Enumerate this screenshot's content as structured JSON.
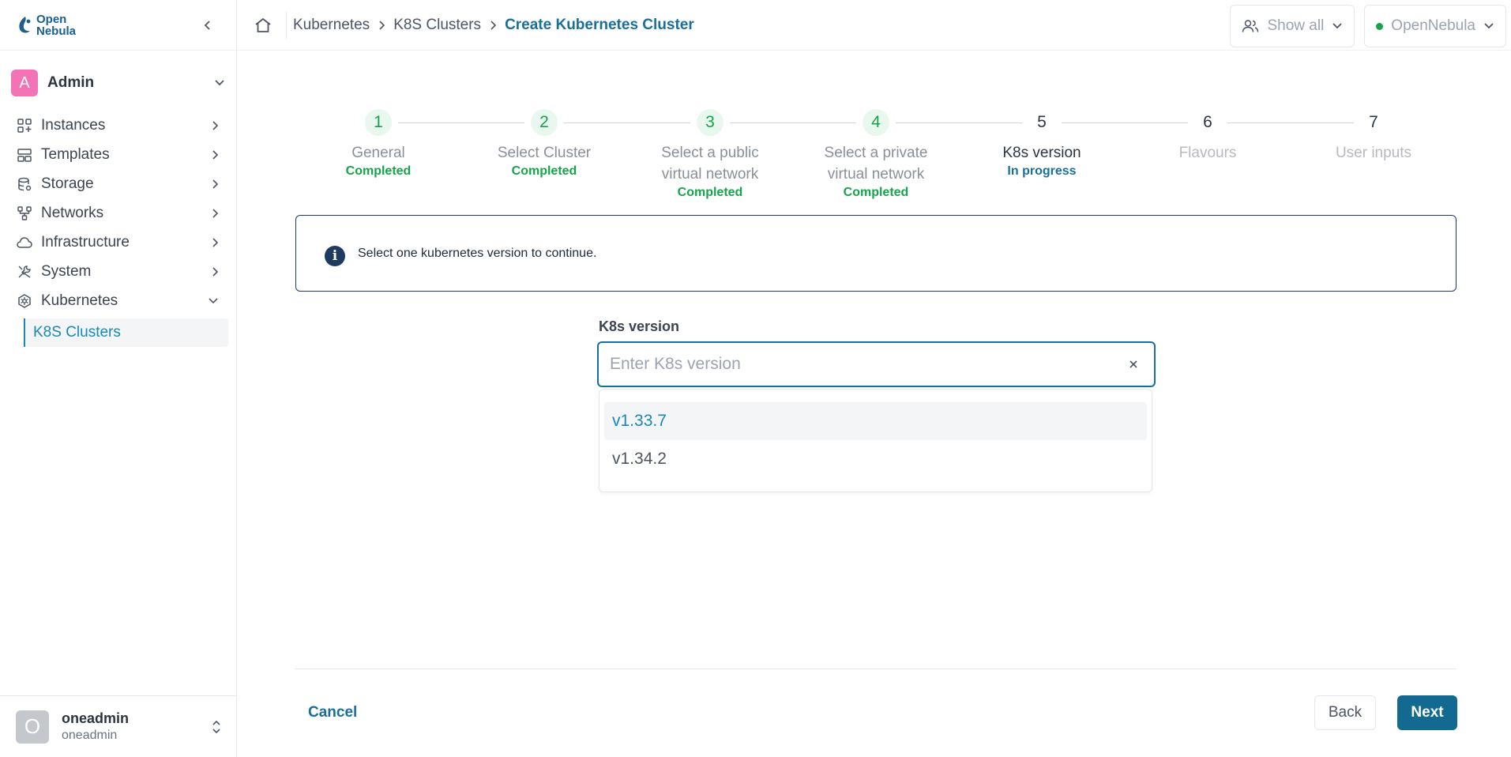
{
  "app": {
    "logo_line1": "Open",
    "logo_line2": "Nebula"
  },
  "sidebar": {
    "group": {
      "avatar_letter": "A",
      "name": "Admin"
    },
    "items": [
      {
        "label": "Instances",
        "icon": "instances-icon"
      },
      {
        "label": "Templates",
        "icon": "templates-icon"
      },
      {
        "label": "Storage",
        "icon": "storage-icon"
      },
      {
        "label": "Networks",
        "icon": "networks-icon"
      },
      {
        "label": "Infrastructure",
        "icon": "cloud-icon"
      },
      {
        "label": "System",
        "icon": "tools-icon"
      },
      {
        "label": "Kubernetes",
        "icon": "kubernetes-icon"
      }
    ],
    "subitem": "K8S Clusters",
    "footer": {
      "avatar_letter": "O",
      "name": "oneadmin",
      "sub": "oneadmin"
    }
  },
  "topbar": {
    "breadcrumbs": [
      "Kubernetes",
      "K8S Clusters"
    ],
    "current": "Create Kubernetes Cluster",
    "show_all": "Show all",
    "zone": "OpenNebula",
    "zone_status_color": "#16a34a"
  },
  "stepper": {
    "steps": [
      {
        "num": "1",
        "label": "General",
        "status": "Completed",
        "state": "done"
      },
      {
        "num": "2",
        "label": "Select Cluster",
        "status": "Completed",
        "state": "done"
      },
      {
        "num": "3",
        "label": "Select a public virtual network",
        "status": "Completed",
        "state": "done"
      },
      {
        "num": "4",
        "label": "Select a private virtual network",
        "status": "Completed",
        "state": "done"
      },
      {
        "num": "5",
        "label": "K8s version",
        "status": "In progress",
        "state": "active"
      },
      {
        "num": "6",
        "label": "Flavours",
        "status": "",
        "state": "pending"
      },
      {
        "num": "7",
        "label": "User inputs",
        "status": "",
        "state": "pending"
      }
    ]
  },
  "alert": {
    "text": "Select one kubernetes version to continue."
  },
  "field": {
    "label": "K8s version",
    "placeholder": "Enter K8s version",
    "value": "",
    "options": [
      "v1.33.7",
      "v1.34.2"
    ]
  },
  "actions": {
    "cancel": "Cancel",
    "back": "Back",
    "next": "Next"
  },
  "colors": {
    "accent": "#1a6f9a",
    "primary_button": "#136a91",
    "completed": "#16a34a"
  }
}
